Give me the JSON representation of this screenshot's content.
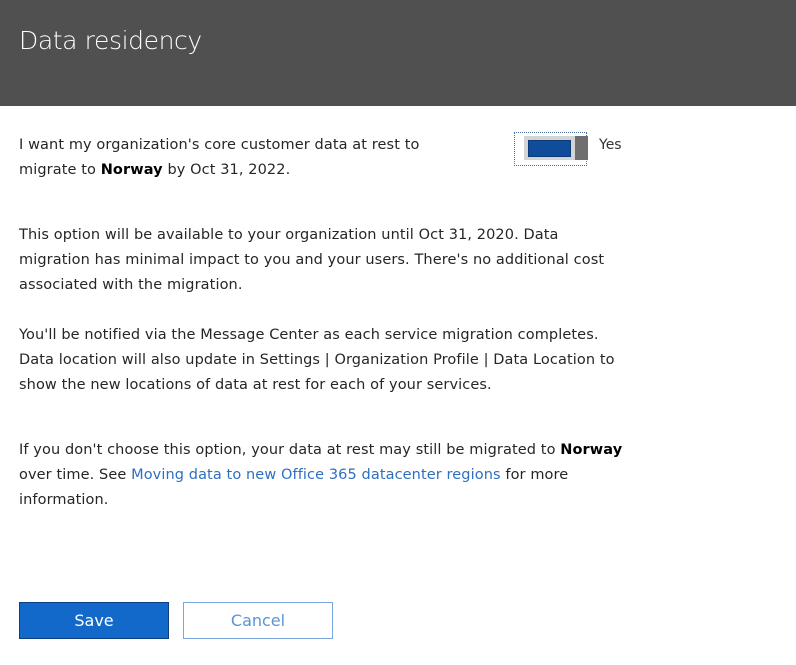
{
  "header": {
    "title": "Data residency"
  },
  "migration_option": {
    "text_before": "I want my organization's core customer data at rest to migrate to ",
    "region": "Norway",
    "text_after": " by Oct 31, 2022.",
    "toggle_on": true,
    "toggle_state_label": "Yes"
  },
  "info": {
    "availability": "This option will be available to your organization until Oct 31, 2020. Data migration has minimal impact to you and your users. There's no additional cost associated with the migration.",
    "notification": "You'll be notified via the Message Center as each service migration completes. Data location will also update in Settings | Organization Profile | Data Location to show the new locations of data at rest for each of your services."
  },
  "fallback": {
    "text_before": "If you don't choose this option, your data at rest may still be migrated to ",
    "region": "Norway",
    "text_middle": " over time. See ",
    "link_text": "Moving data to new Office 365 datacenter regions",
    "text_after": " for more information."
  },
  "actions": {
    "save_label": "Save",
    "cancel_label": "Cancel"
  },
  "colors": {
    "header_bg": "#505050",
    "accent": "#1269c9",
    "toggle_on": "#0f4d9b",
    "link": "#2f6fc2"
  }
}
